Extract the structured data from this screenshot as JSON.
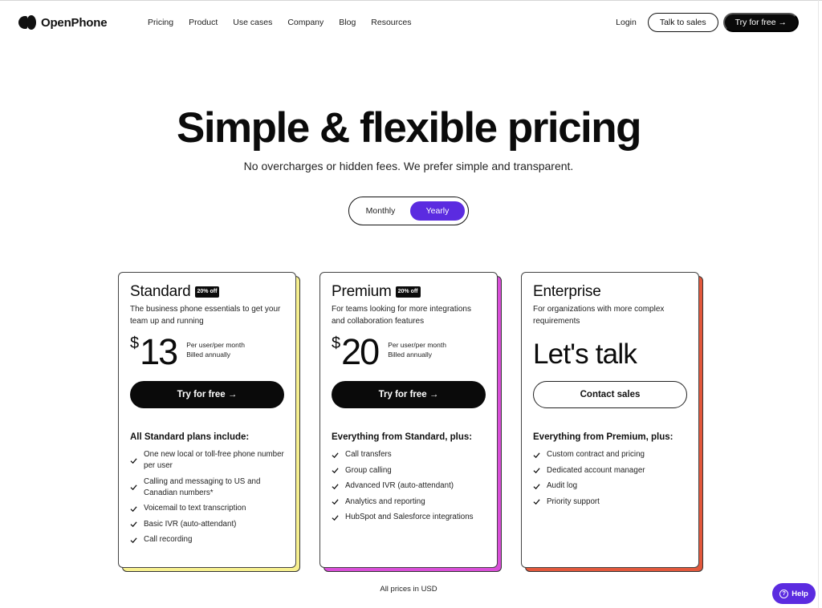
{
  "brand": {
    "name": "OpenPhone",
    "accent": "#5b2be0"
  },
  "nav": {
    "links": [
      "Pricing",
      "Product",
      "Use cases",
      "Company",
      "Blog",
      "Resources"
    ],
    "login": "Login",
    "talk_to_sales": "Talk to sales",
    "try_free": "Try for free →"
  },
  "hero": {
    "title": "Simple & flexible pricing",
    "subtitle": "No overcharges or hidden fees. We prefer simple and transparent."
  },
  "billing_toggle": {
    "options": [
      "Monthly",
      "Yearly"
    ],
    "selected": "Yearly"
  },
  "plans": [
    {
      "name": "Standard",
      "badge": "20% off",
      "description": "The business phone essentials to get your team up and running",
      "currency": "$",
      "price": "13",
      "price_meta_1": "Per user/per month",
      "price_meta_2": "Billed annually",
      "cta": "Try for free →",
      "features_heading": "All Standard plans include:",
      "features": [
        "One new local or toll-free phone number per user",
        "Calling and messaging to US and Canadian numbers*",
        "Voicemail to text transcription",
        "Basic IVR (auto-attendant)",
        "Call recording"
      ],
      "shadow_color": "#f7f08f"
    },
    {
      "name": "Premium",
      "badge": "20% off",
      "description": "For teams looking for more integrations and collaboration features",
      "currency": "$",
      "price": "20",
      "price_meta_1": "Per user/per month",
      "price_meta_2": "Billed annually",
      "cta": "Try for free →",
      "features_heading": "Everything from Standard, plus:",
      "features": [
        "Call transfers",
        "Group calling",
        "Advanced IVR (auto-attendant)",
        "Analytics and reporting",
        "HubSpot and Salesforce integrations"
      ],
      "shadow_color": "#d94fd8"
    },
    {
      "name": "Enterprise",
      "description": "For organizations with more complex requirements",
      "price_text": "Let's talk",
      "cta": "Contact sales",
      "features_heading": "Everything from Premium, plus:",
      "features": [
        "Custom contract and pricing",
        "Dedicated account manager",
        "Audit log",
        "Priority support"
      ],
      "shadow_color": "#e2583c"
    }
  ],
  "footer": {
    "note": "All prices in USD"
  },
  "help": {
    "label": "Help",
    "icon": "?"
  }
}
